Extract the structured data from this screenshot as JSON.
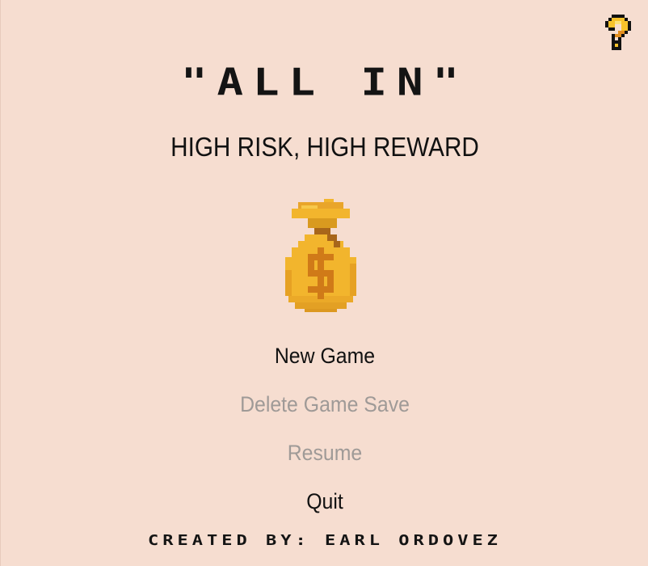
{
  "title": "\"ALL IN\"",
  "subtitle": "HIGH RISK, HIGH REWARD",
  "help_icon": "question-mark-icon",
  "logo_icon": "money-bag-icon",
  "menu": {
    "new_game": "New Game",
    "delete_save": "Delete Game Save",
    "resume": "Resume",
    "quit": "Quit"
  },
  "credits": "CREATED BY: EARL ORDOVEZ",
  "colors": {
    "background": "#f6ddd0",
    "text_enabled": "#111111",
    "text_disabled": "#9f9a97",
    "gold": "#f2b52d",
    "gold_dark": "#d08a1a"
  }
}
